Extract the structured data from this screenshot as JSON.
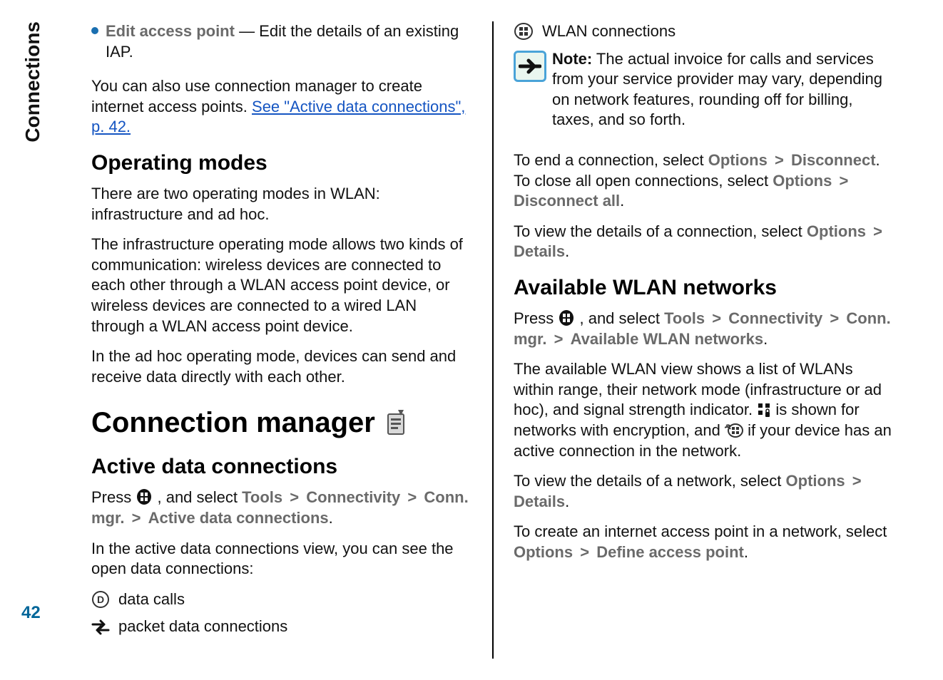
{
  "side_label": "Connections",
  "page_number": "42",
  "left": {
    "bullet_label": "Edit access point",
    "bullet_rest": "  — Edit the details of an existing IAP.",
    "p1a": "You can also use connection manager to create internet access points. ",
    "link_text": "See \"Active data connections\", p. 42.",
    "h2_modes": "Operating modes",
    "p2": "There are two operating modes in WLAN: infrastructure and ad hoc.",
    "p3": "The infrastructure operating mode allows two kinds of communication: wireless devices are connected to each other through a WLAN access point device, or wireless devices are connected to a wired LAN through a WLAN access point device.",
    "p4": "In the ad hoc operating mode, devices can send and receive data directly with each other.",
    "h1_connmgr": "Connection manager",
    "h2_active": "Active data connections",
    "press": "Press ",
    "and_select": " , and select ",
    "tools": "Tools",
    "connectivity": "Connectivity",
    "conn_mgr": "Conn. mgr.",
    "active_dc": "Active data connections",
    "period": ".",
    "p5": "In the active data connections view, you can see the open data connections:",
    "li_data_calls": "data calls",
    "li_packet": "packet data connections"
  },
  "right": {
    "wlan_conn": "WLAN connections",
    "note_label": "Note:",
    "note_body": " The actual invoice for calls and services from your service provider may vary, depending on network features, rounding off for billing, taxes, and so forth.",
    "p1a": "To end a connection, select ",
    "options": "Options",
    "disconnect": "Disconnect",
    "p1b": ". To close all open connections, select ",
    "disconnect_all": "Disconnect all",
    "p2a": "To view the details of a connection, select ",
    "details": "Details",
    "h2_avail": "Available WLAN networks",
    "press": "Press ",
    "and_select": " , and select ",
    "tools": "Tools",
    "connectivity": "Connectivity",
    "conn_mgr": "Conn. mgr.",
    "avail_wlan": "Available WLAN networks",
    "p3a": "The available WLAN view shows a list of WLANs within range, their network mode (infrastructure or ad hoc), and signal strength indicator. ",
    "p3b": " is shown for networks with encryption, and ",
    "p3c": " if your device has an active connection in the network.",
    "p4a": "To view the details of a network, select ",
    "p5a": "To create an internet access point in a network, select ",
    "define_ap": "Define access point"
  },
  "sep": ">"
}
